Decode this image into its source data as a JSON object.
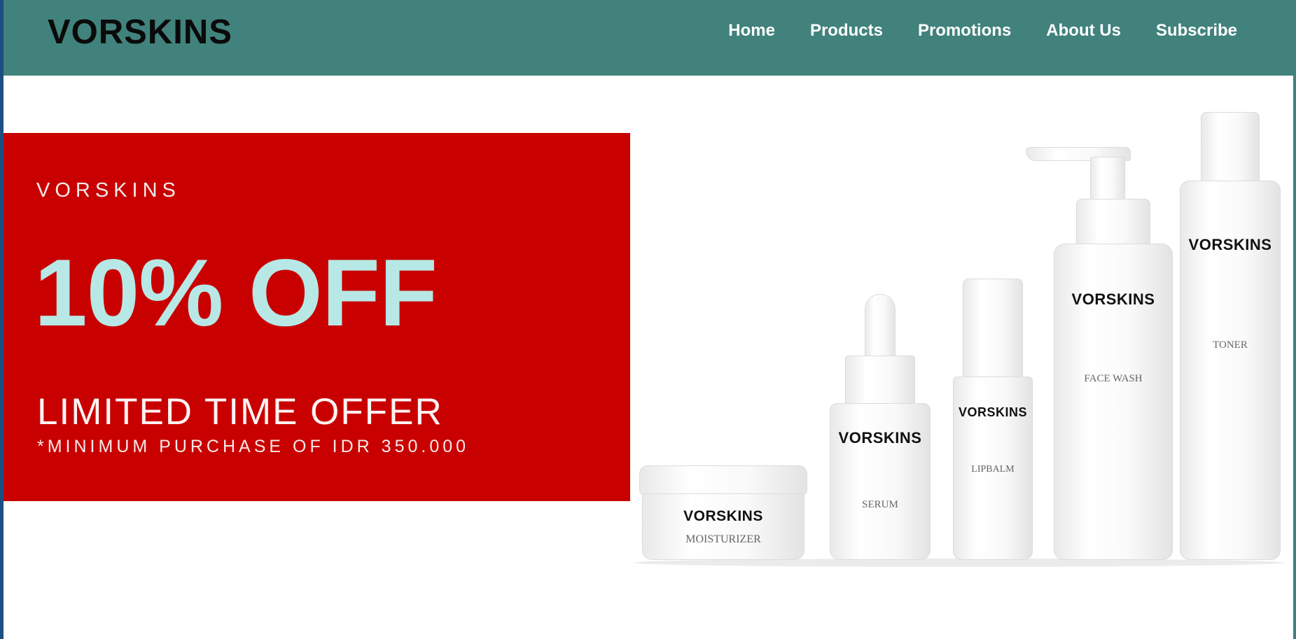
{
  "site": {
    "brand": "VORSKINS"
  },
  "nav": {
    "items": [
      {
        "label": "Home"
      },
      {
        "label": "Products"
      },
      {
        "label": "Promotions"
      },
      {
        "label": "About Us"
      },
      {
        "label": "Subscribe"
      }
    ]
  },
  "promo": {
    "brand": "VORSKINS",
    "discount": "10% OFF",
    "headline": "LIMITED TIME OFFER",
    "note": "*MINIMUM PURCHASE OF IDR 350.000"
  },
  "products": [
    {
      "brand": "VORSKINS",
      "name": "MOISTURIZER"
    },
    {
      "brand": "VORSKINS",
      "name": "SERUM"
    },
    {
      "brand": "VORSKINS",
      "name": "LIPBALM"
    },
    {
      "brand": "VORSKINS",
      "name": "FACE WASH"
    },
    {
      "brand": "VORSKINS",
      "name": "TONER"
    }
  ],
  "colors": {
    "navbar": "#41827c",
    "promo_background": "#c90000",
    "discount_text": "#b7e8e6"
  }
}
